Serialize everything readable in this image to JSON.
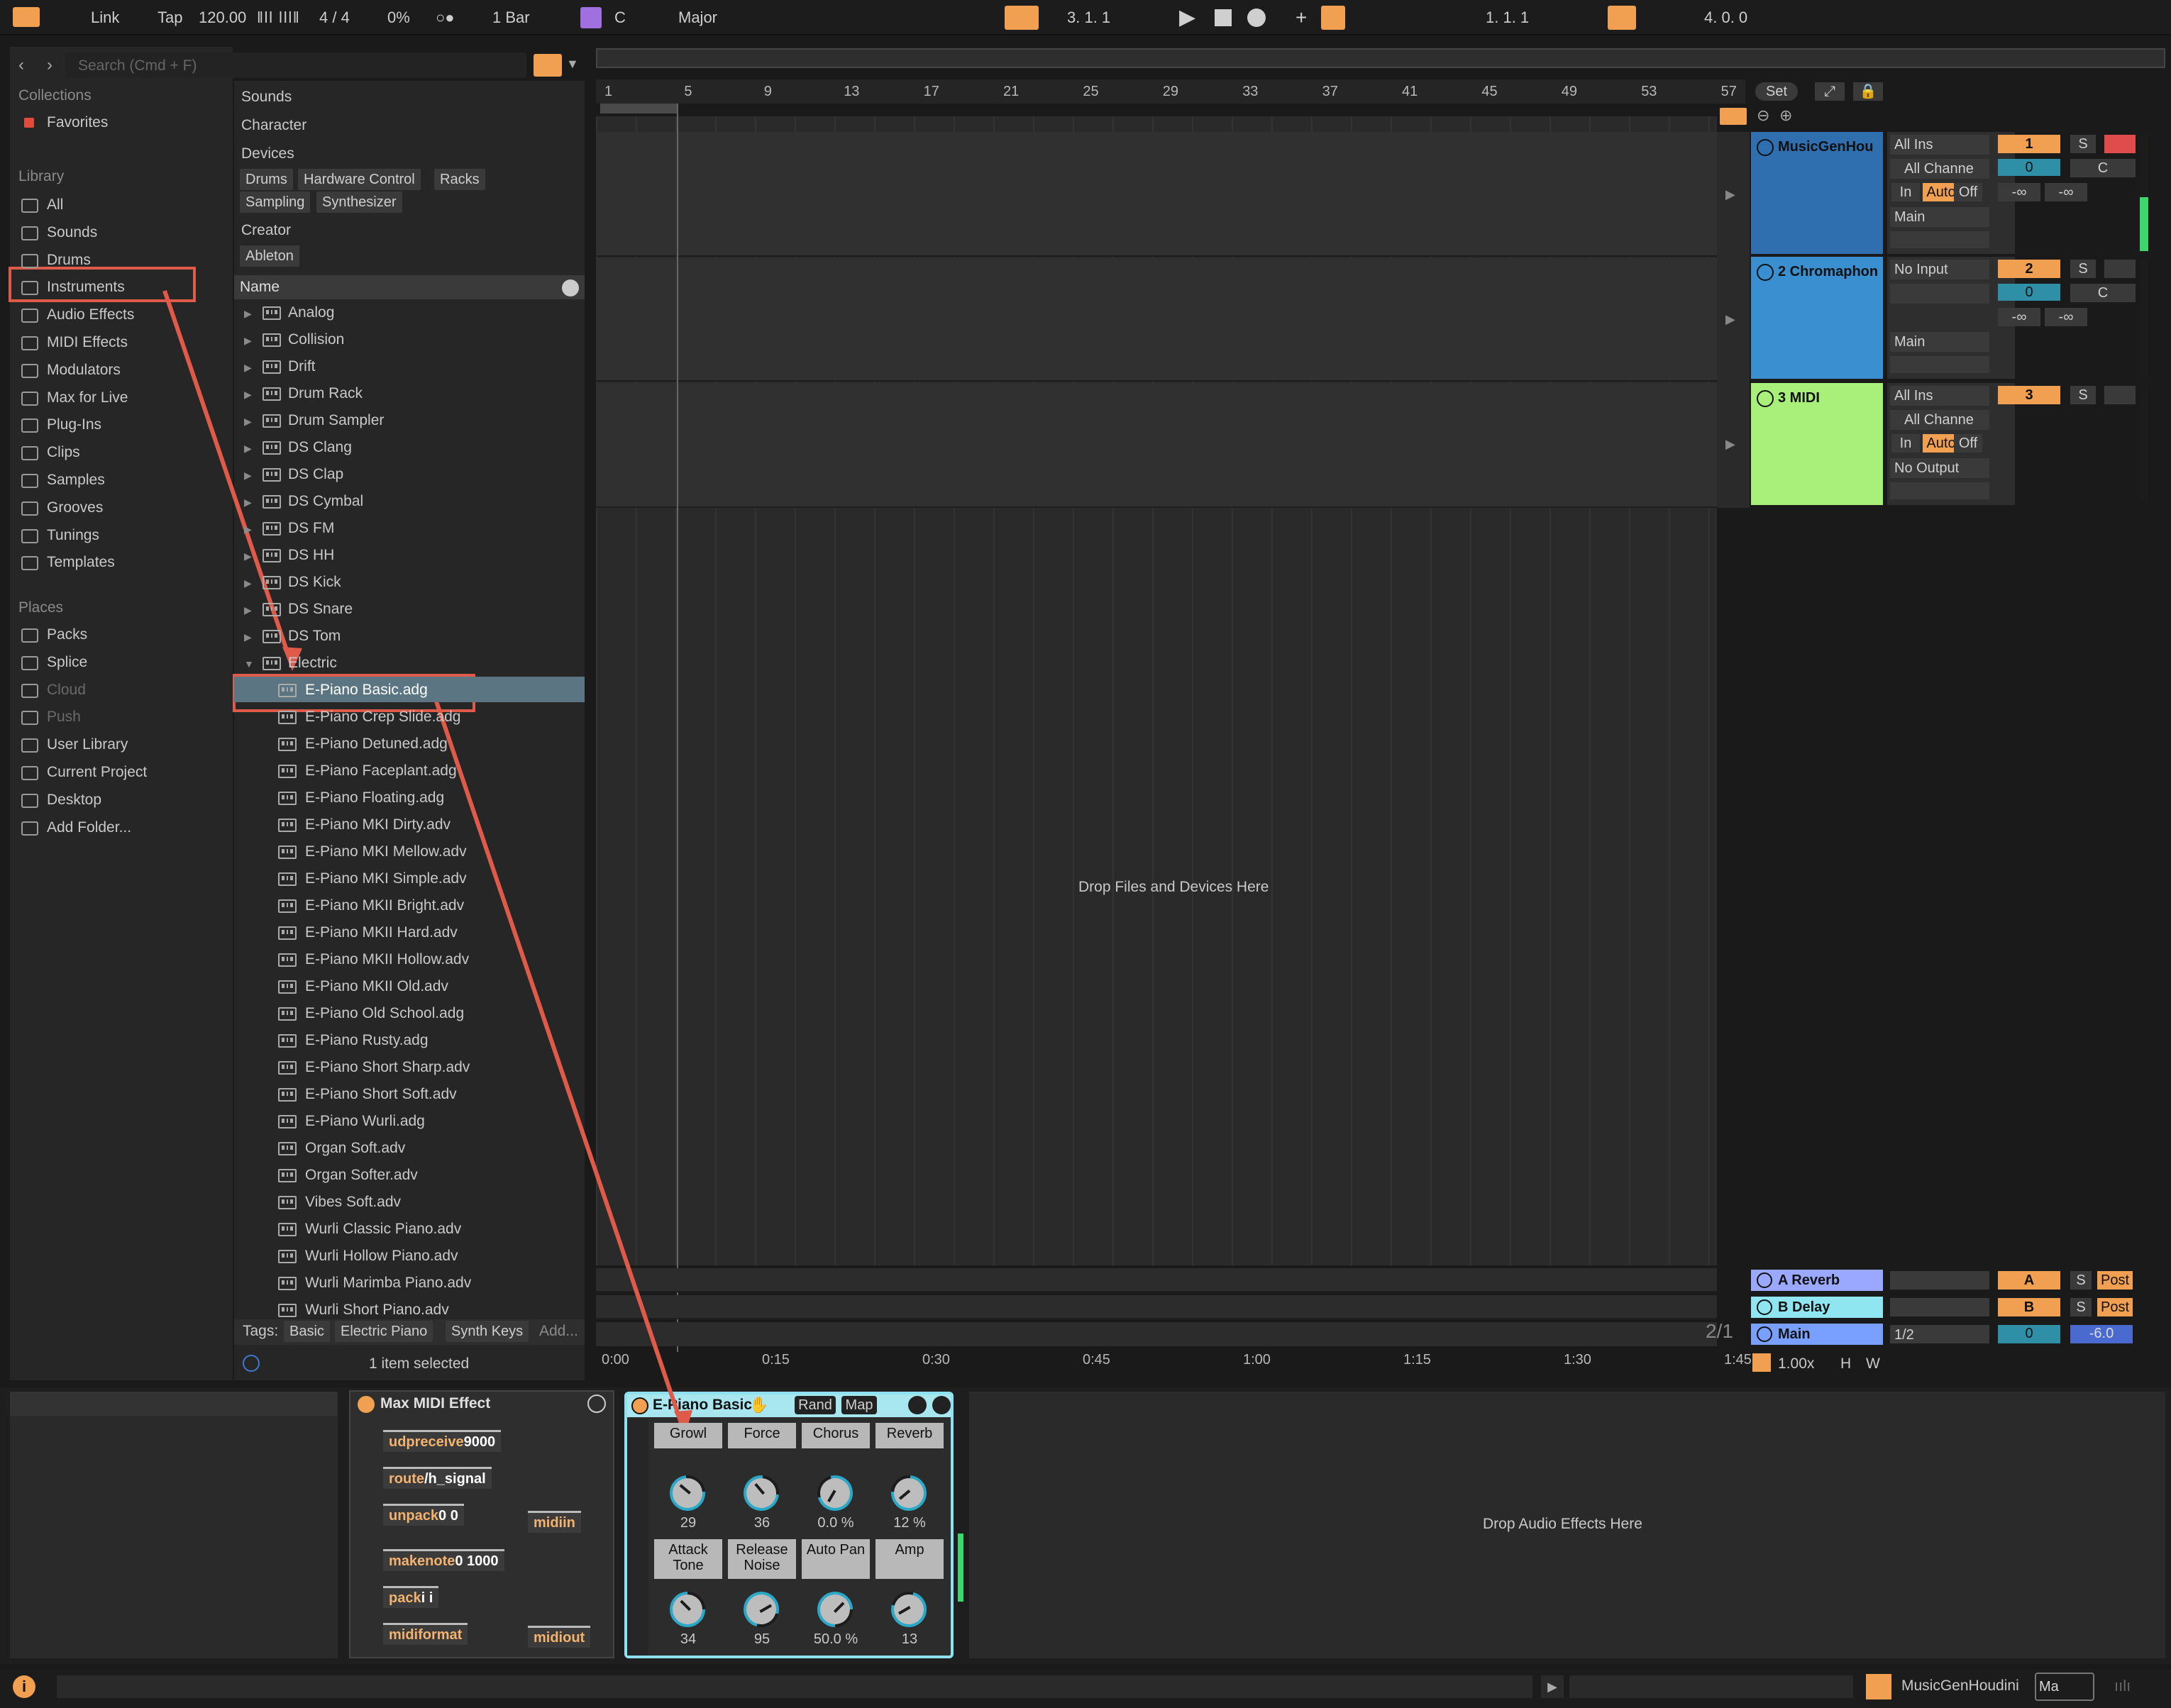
{
  "transport": {
    "link": "Link",
    "tap": "Tap",
    "tempo": "120.00",
    "meter": "4 / 4",
    "swing": "0%",
    "quantize": "1 Bar",
    "key": "C",
    "scale": "Major",
    "arrangement_pos": "3.  1.  1",
    "loop_start": "1.  1.  1",
    "loop_length": "4.  0.  0"
  },
  "browser": {
    "search_placeholder": "Search (Cmd + F)",
    "collections_header": "Collections",
    "favorites": "Favorites",
    "library_header": "Library",
    "library_items": [
      "All",
      "Sounds",
      "Drums",
      "Instruments",
      "Audio Effects",
      "MIDI Effects",
      "Modulators",
      "Max for Live",
      "Plug-Ins",
      "Clips",
      "Samples",
      "Grooves",
      "Tunings",
      "Templates"
    ],
    "places_header": "Places",
    "places_items": [
      "Packs",
      "Splice",
      "Cloud",
      "Push",
      "User Library",
      "Current Project",
      "Desktop",
      "Add Folder..."
    ],
    "filters": {
      "sounds": "Sounds",
      "character": "Character",
      "devices": "Devices",
      "creator": "Creator"
    },
    "device_tags": [
      "Drums",
      "Hardware Control",
      "Racks",
      "Sampling",
      "Synthesizer"
    ],
    "creator_tags": [
      "Ableton"
    ],
    "name_header": "Name",
    "folders": [
      "Analog",
      "Collision",
      "Drift",
      "Drum Rack",
      "Drum Sampler",
      "DS Clang",
      "DS Clap",
      "DS Cymbal",
      "DS FM",
      "DS HH",
      "DS Kick",
      "DS Snare",
      "DS Tom",
      "Electric"
    ],
    "files": [
      "E-Piano Basic.adg",
      "E-Piano Crep Slide.adg",
      "E-Piano Detuned.adg",
      "E-Piano Faceplant.adg",
      "E-Piano Floating.adg",
      "E-Piano MKI Dirty.adv",
      "E-Piano MKI Mellow.adv",
      "E-Piano MKI Simple.adv",
      "E-Piano MKII Bright.adv",
      "E-Piano MKII Hard.adv",
      "E-Piano MKII Hollow.adv",
      "E-Piano MKII Old.adv",
      "E-Piano Old School.adg",
      "E-Piano Rusty.adg",
      "E-Piano Short Sharp.adv",
      "E-Piano Short Soft.adv",
      "E-Piano Wurli.adg",
      "Organ Soft.adv",
      "Organ Softer.adv",
      "Vibes Soft.adv",
      "Wurli Classic Piano.adv",
      "Wurli Hollow Piano.adv",
      "Wurli Marimba Piano.adv",
      "Wurli Short Piano.adv"
    ],
    "tags_label": "Tags:",
    "tags": [
      "Basic",
      "Electric Piano",
      "Synth Keys"
    ],
    "tags_add": "Add...",
    "status": "1 item selected"
  },
  "arrangement": {
    "bars": [
      "1",
      "5",
      "9",
      "13",
      "17",
      "21",
      "25",
      "29",
      "33",
      "37",
      "41",
      "45",
      "49",
      "53",
      "57"
    ],
    "times": [
      "0:00",
      "0:15",
      "0:30",
      "0:45",
      "1:00",
      "1:15",
      "1:30",
      "1:45"
    ],
    "drop_text": "Drop Files and Devices Here",
    "set_label": "Set",
    "page_indicator": "2/1"
  },
  "tracks": [
    {
      "name": "MusicGenHou",
      "input": "All Ins",
      "channel": "All Channe",
      "mon": [
        "In",
        "Auto",
        "Off"
      ],
      "output": "Main",
      "num": "1",
      "vol": "0",
      "pan": "C",
      "color": "#2f6fb0"
    },
    {
      "name": "2 Chromaphon",
      "input": "No Input",
      "channel": "",
      "mon": [],
      "output": "Main",
      "num": "2",
      "vol": "0",
      "pan": "C",
      "color": "#3a8fd0"
    },
    {
      "name": "3 MIDI",
      "input": "All Ins",
      "channel": "All Channe",
      "mon": [
        "In",
        "Auto",
        "Off"
      ],
      "output": "No Output",
      "num": "3",
      "vol": "",
      "pan": "",
      "color": "#a8f07a"
    }
  ],
  "returns": [
    {
      "name": "A Reverb",
      "letter": "A",
      "post": "Post",
      "color": "#9aa8ff"
    },
    {
      "name": "B Delay",
      "letter": "B",
      "post": "Post",
      "color": "#8fe6f0"
    },
    {
      "name": "Main",
      "letter": "0",
      "post": "-6.0",
      "color": "#7aa0ff",
      "extra": "1/2"
    }
  ],
  "zoom": {
    "value": "1.00x",
    "h": "H",
    "w": "W"
  },
  "meter_values": {
    "inf": "-∞"
  },
  "max_device": {
    "title": "Max MIDI Effect",
    "objects": [
      {
        "name": "udpreceive",
        "arg": "9000"
      },
      {
        "name": "route",
        "arg": "/h_signal"
      },
      {
        "name": "unpack",
        "arg": "0 0"
      },
      {
        "name": "makenote",
        "arg": "0 1000"
      },
      {
        "name": "pack",
        "arg": "i i"
      },
      {
        "name": "midiformat",
        "arg": ""
      },
      {
        "name": "midiin",
        "arg": ""
      },
      {
        "name": "midiout",
        "arg": ""
      }
    ]
  },
  "rack": {
    "title": "E-Piano Basic",
    "rand": "Rand",
    "map": "Map",
    "macros": [
      {
        "label": "Growl",
        "value": "29"
      },
      {
        "label": "Force",
        "value": "36"
      },
      {
        "label": "Chorus",
        "value": "0.0 %"
      },
      {
        "label": "Reverb",
        "value": "12 %"
      },
      {
        "label": "Attack Tone",
        "value": "34"
      },
      {
        "label": "Release Noise",
        "value": "95"
      },
      {
        "label": "Auto Pan",
        "value": "50.0 %"
      },
      {
        "label": "Amp",
        "value": "13"
      }
    ]
  },
  "device_drop_text": "Drop Audio Effects Here",
  "status_bar": {
    "track_name": "MusicGenHoudini",
    "box": "Ma"
  }
}
